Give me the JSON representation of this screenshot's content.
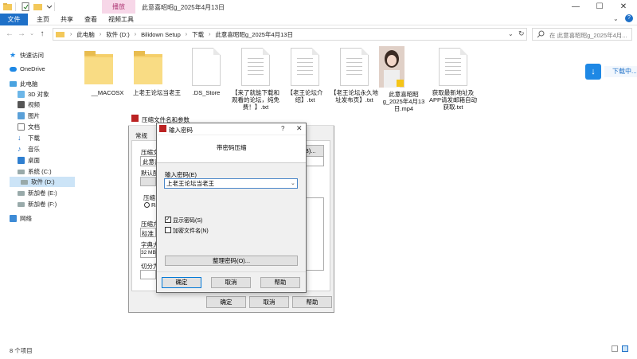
{
  "window": {
    "title": "此意喜昭昭g_2025年4月13日",
    "contextual_tab": "播放",
    "minimize_icon": "minimize-icon",
    "maximize_icon": "maximize-icon",
    "close_icon": "close-icon"
  },
  "ribbon": {
    "tabs": [
      "文件",
      "主页",
      "共享",
      "查看",
      "视频工具"
    ]
  },
  "address": {
    "breadcrumbs": [
      "此电脑",
      "软件 (D:)",
      "Bilidown Setup",
      "下载",
      "此意喜昭昭g_2025年4月13日"
    ],
    "search_placeholder": "在 此意喜昭昭g_2025年4月..."
  },
  "sidebar": {
    "items": [
      {
        "label": "快速访问",
        "icon": "star-icon"
      },
      {
        "label": "OneDrive",
        "icon": "cloud-icon"
      },
      {
        "label": "此电脑",
        "icon": "computer-icon"
      },
      {
        "label": "3D 对象",
        "icon": "cube-icon"
      },
      {
        "label": "视频",
        "icon": "video-icon"
      },
      {
        "label": "图片",
        "icon": "image-icon"
      },
      {
        "label": "文档",
        "icon": "document-icon"
      },
      {
        "label": "下载",
        "icon": "download-icon"
      },
      {
        "label": "音乐",
        "icon": "music-icon"
      },
      {
        "label": "桌面",
        "icon": "desktop-icon"
      },
      {
        "label": "系统 (C:)",
        "icon": "drive-icon"
      },
      {
        "label": "软件 (D:)",
        "icon": "drive-icon"
      },
      {
        "label": "新加卷 (E:)",
        "icon": "drive-icon"
      },
      {
        "label": "新加卷 (F:)",
        "icon": "drive-icon"
      },
      {
        "label": "网络",
        "icon": "network-icon"
      }
    ]
  },
  "files": [
    {
      "name": "__MACOSX",
      "type": "folder"
    },
    {
      "name": "上老王论坛当老王",
      "type": "folder"
    },
    {
      "name": ".DS_Store",
      "type": "file"
    },
    {
      "name": "【来了就能下载和观看的论坛，纯免费！】.txt",
      "type": "txt"
    },
    {
      "name": "【老王论坛介绍】.txt",
      "type": "txt"
    },
    {
      "name": "【老王论坛永久地址发布页】.txt",
      "type": "txt"
    },
    {
      "name": "此意喜昭昭g_2025年4月13日.mp4",
      "type": "video"
    },
    {
      "name": "获取最新地址及APP请发邮箱自动获取.txt",
      "type": "txt"
    }
  ],
  "download_tab": {
    "label": "下载中..."
  },
  "bg_dialog": {
    "title": "压缩文件名和参数",
    "tab_general": "常规",
    "label_archive": "压缩文",
    "archive_value": "此意喜",
    "browse_label": "浏览(B)...",
    "label_default": "默认配",
    "label_format": "压缩",
    "radio_label": "Ra",
    "label_method": "压缩方",
    "method_value": "标准",
    "label_dict": "字典大",
    "dict_value": "32 MB",
    "label_split": "切分为",
    "ok_label": "确定",
    "cancel_label": "取消",
    "help_label": "帮助"
  },
  "dialog": {
    "title": "输入密码",
    "help_icon": "?",
    "heading": "带密码压缩",
    "password_label": "输入密码(E)",
    "password_value": "上老王论坛当老王",
    "show_password_label": "显示密码(S)",
    "show_password_checked": true,
    "encrypt_names_label": "加密文件名(N)",
    "encrypt_names_checked": false,
    "organize_label": "整理密码(O)...",
    "ok_label": "确定",
    "cancel_label": "取消",
    "help_label": "帮助"
  },
  "status": {
    "item_count": "8 个项目"
  }
}
